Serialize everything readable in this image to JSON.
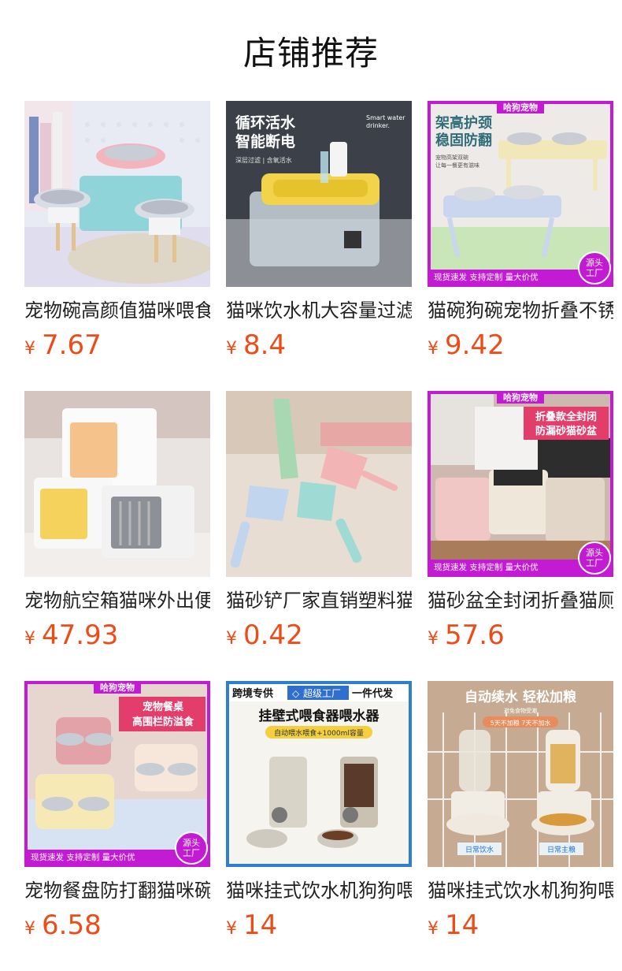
{
  "page_title": "店铺推荐",
  "currency_symbol": "¥",
  "products": [
    {
      "name": "宠物碗高颜值猫咪喂食碗",
      "price": "7.67"
    },
    {
      "name": "猫咪饮水机大容量过滤器",
      "price": "8.4"
    },
    {
      "name": "猫碗狗碗宠物折叠不锈钢碗",
      "price": "9.42"
    },
    {
      "name": "宠物航空箱猫咪外出便携",
      "price": "47.93"
    },
    {
      "name": "猫砂铲厂家直销塑料猫砂",
      "price": "0.42"
    },
    {
      "name": "猫砂盆全封闭折叠猫厕所",
      "price": "57.6"
    },
    {
      "name": "宠物餐盘防打翻猫咪碗架",
      "price": "6.58"
    },
    {
      "name": "猫咪挂式饮水机狗狗喂食",
      "price": "14"
    },
    {
      "name": "猫咪挂式饮水机狗狗喂食",
      "price": "14"
    }
  ],
  "image_text": {
    "p2": {
      "line1": "循环活水",
      "line2": "智能断电",
      "sub": "深层过滤 | 含氧活水",
      "en1": "Smart water",
      "en2": "drinker."
    },
    "p3": {
      "brand": "哈狗宠物",
      "line1": "架高护颈",
      "line2": "稳固防翻",
      "sub1": "宠物高架双碗",
      "sub2": "让每一餐更有滋味",
      "footer": "现货速发 支持定制 量大价优",
      "badge1": "源头",
      "badge2": "工厂"
    },
    "p6": {
      "brand": "哈狗宠物",
      "line1": "折叠款全封闭",
      "line2": "防漏砂猫砂盆",
      "footer": "现货速发 支持定制 量大价优",
      "badge1": "源头",
      "badge2": "工厂"
    },
    "p7": {
      "brand": "哈狗宠物",
      "line1": "宠物餐桌",
      "line2": "高围栏防溢食",
      "footer": "现货速发 支持定制 量大价优",
      "badge1": "源头",
      "badge2": "工厂"
    },
    "p8": {
      "tag1": "跨境专供",
      "tag2": "超级工厂",
      "tag3": "一件代发",
      "headline": "挂壁式喂食器喂水器",
      "pill": "自动喂水喂食+1000ml容量"
    },
    "p9": {
      "headline": "自动续水 轻松加粮",
      "sub1": "避免食物受潮 ",
      "sub2": "5天不加粮 7天不加水",
      "label1": "日常饮水",
      "label2": "日常主粮"
    }
  },
  "colors": {
    "price": "#ee4b17",
    "brand_magenta": "#c21bd3"
  }
}
